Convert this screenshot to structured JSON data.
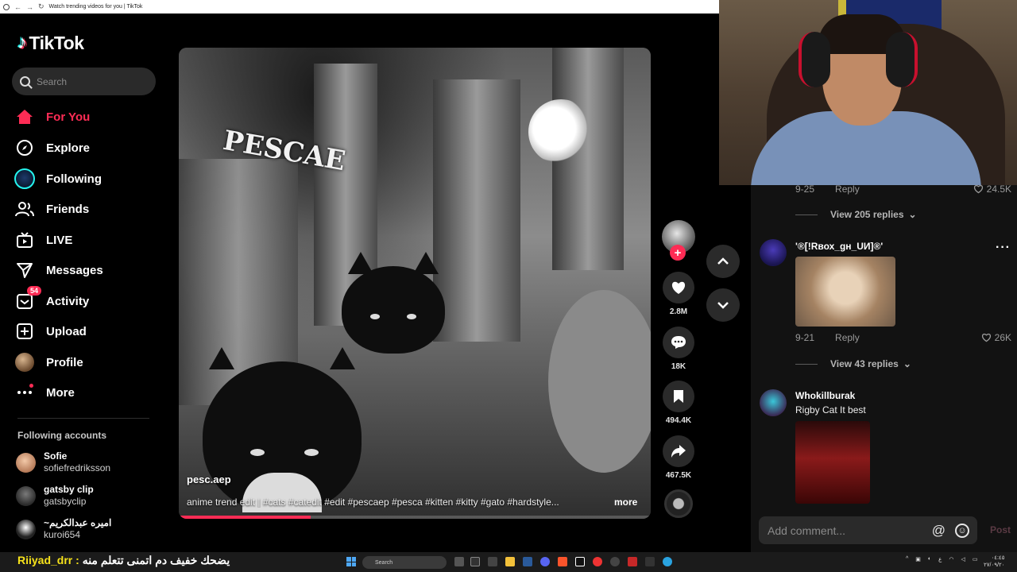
{
  "browser": {
    "tab_title": "Watch trending videos for you | TikTok"
  },
  "sidebar": {
    "logo": "TikTok",
    "search_placeholder": "Search",
    "nav": [
      {
        "label": "For You",
        "icon": "home-icon",
        "active": true
      },
      {
        "label": "Explore",
        "icon": "compass-icon"
      },
      {
        "label": "Following",
        "icon": "following-avatar-icon"
      },
      {
        "label": "Friends",
        "icon": "friends-icon"
      },
      {
        "label": "LIVE",
        "icon": "live-tv-icon"
      },
      {
        "label": "Messages",
        "icon": "send-icon"
      },
      {
        "label": "Activity",
        "icon": "inbox-icon",
        "badge": "54"
      },
      {
        "label": "Upload",
        "icon": "plus-square-icon"
      },
      {
        "label": "Profile",
        "icon": "profile-avatar-icon"
      },
      {
        "label": "More",
        "icon": "more-dots-icon"
      }
    ],
    "following_title": "Following accounts",
    "following_accounts": [
      {
        "name": "Sofie",
        "username": "sofiefredriksson"
      },
      {
        "name": "gatsby clip",
        "username": "gatsbyclip"
      },
      {
        "name": "~اميره عبدالكريم",
        "username": "kuroi654"
      }
    ]
  },
  "video": {
    "username": "pesc.aep",
    "caption": "anime trend edit | #cats #catedit #edit #pescaep #pesca #kitten #kitty #gato #hardstyle...",
    "more_label": "more",
    "progress_fraction": 0.28,
    "overlay_logo_text": "PESCAE"
  },
  "actions": {
    "likes": "2.8M",
    "comments": "18K",
    "saves": "494.4K",
    "shares": "467.5K"
  },
  "comments": {
    "items": [
      {
        "date": "9-25",
        "reply": "Reply",
        "likes": "24.5K",
        "view_replies": "View 205 replies"
      },
      {
        "author": "'®[!Rвох_gн_UИ]®'",
        "date": "9-21",
        "reply": "Reply",
        "likes": "26K",
        "view_replies": "View 43 replies"
      },
      {
        "author": "Whokillburak",
        "text": "Rigby Cat It best"
      }
    ],
    "input_placeholder": "Add comment...",
    "post_label": "Post"
  },
  "stream_chat": {
    "user": "Riiyad_drr :",
    "message": "يضحك خفيف دم اتمنى تتعلم منه"
  },
  "taskbar": {
    "search_label": "Search"
  },
  "colors": {
    "accent": "#fe2c55",
    "background": "#000000",
    "panel": "#121212"
  }
}
